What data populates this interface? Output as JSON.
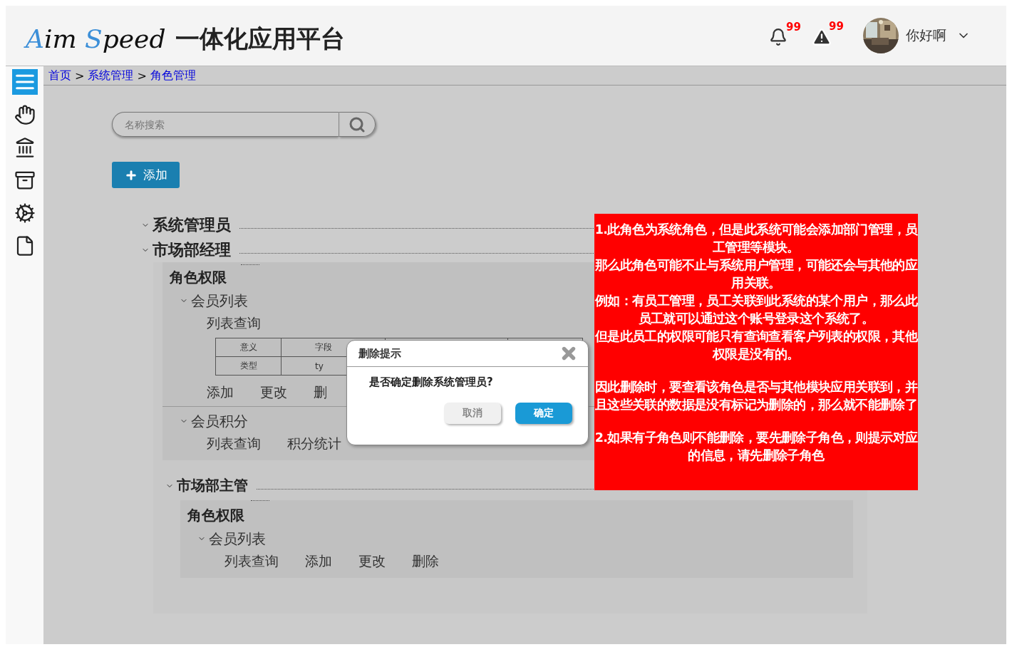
{
  "header": {
    "logo": [
      {
        "text": "A",
        "accent": true
      },
      {
        "text": "im ",
        "accent": false
      },
      {
        "text": "S",
        "accent": true
      },
      {
        "text": "peed",
        "accent": false
      }
    ],
    "title": "一体化应用平台",
    "notifications": [
      {
        "kind": "bell",
        "count": "99"
      },
      {
        "kind": "warning",
        "count": "99"
      }
    ],
    "user": {
      "name": "你好啊"
    }
  },
  "sidebar": {
    "items": [
      {
        "kind": "list",
        "selected": true
      },
      {
        "kind": "hand",
        "selected": false
      },
      {
        "kind": "bank",
        "selected": false
      },
      {
        "kind": "archive",
        "selected": false
      },
      {
        "kind": "gears",
        "selected": false
      },
      {
        "kind": "file",
        "selected": false
      }
    ]
  },
  "breadcrumb": {
    "items": [
      "首页",
      "系统管理",
      "角色管理"
    ],
    "separator": ">"
  },
  "search": {
    "placeholder": "名称搜索"
  },
  "add_button": "添加",
  "roles": [
    {
      "name": "系统管理员"
    },
    {
      "name": "市场部经理",
      "permissions": {
        "title": "角色权限",
        "modules": [
          {
            "name": "会员列表",
            "rows": [
              {
                "kind": "items",
                "items": [
                  "列表查询"
                ]
              },
              {
                "kind": "table",
                "cells": [
                  [
                    "意义",
                    "字段"
                  ],
                  [
                    "类型",
                    "ty"
                  ]
                ]
              },
              {
                "kind": "items",
                "items": [
                  "添加",
                  "更改",
                  "删"
                ]
              }
            ]
          },
          {
            "name": "会员积分",
            "rows": [
              {
                "kind": "items",
                "items": [
                  "列表查询",
                  "积分统计"
                ]
              }
            ]
          }
        ]
      },
      "children": [
        {
          "name": "市场部主管",
          "permissions": {
            "title": "角色权限",
            "modules": [
              {
                "name": "会员列表",
                "rows": [
                  {
                    "kind": "items",
                    "items": [
                      "列表查询",
                      "添加",
                      "更改",
                      "删除"
                    ]
                  }
                ]
              }
            ]
          }
        }
      ]
    }
  ],
  "dialog": {
    "title": "删除提示",
    "message": "是否确定删除系统管理员?",
    "buttons": [
      {
        "label": "取消",
        "primary": false
      },
      {
        "label": "确定",
        "primary": true
      }
    ]
  },
  "annotation": {
    "paragraphs": [
      [
        "1.此角色为系统角色，但是此系统可能会添加部门管理，员工管理等模块。",
        "那么此角色可能不止与系统用户管理，可能还会与其他的应用关联。",
        "例如：有员工管理，员工关联到此系统的某个用户，那么此员工就可以通过这个账号登录这个系统了。",
        "但是此员工的权限可能只有查询查看客户列表的权限，其他权限是没有的。"
      ],
      [
        "因此删除时，要查看该角色是否与其他模块应用关联到，并且这些关联的数据是没有标记为删除的，那么就不能删除了"
      ],
      [
        "2.如果有子角色则不能删除，要先删除子角色，则提示对应的信息，请先删除子角色"
      ]
    ]
  }
}
